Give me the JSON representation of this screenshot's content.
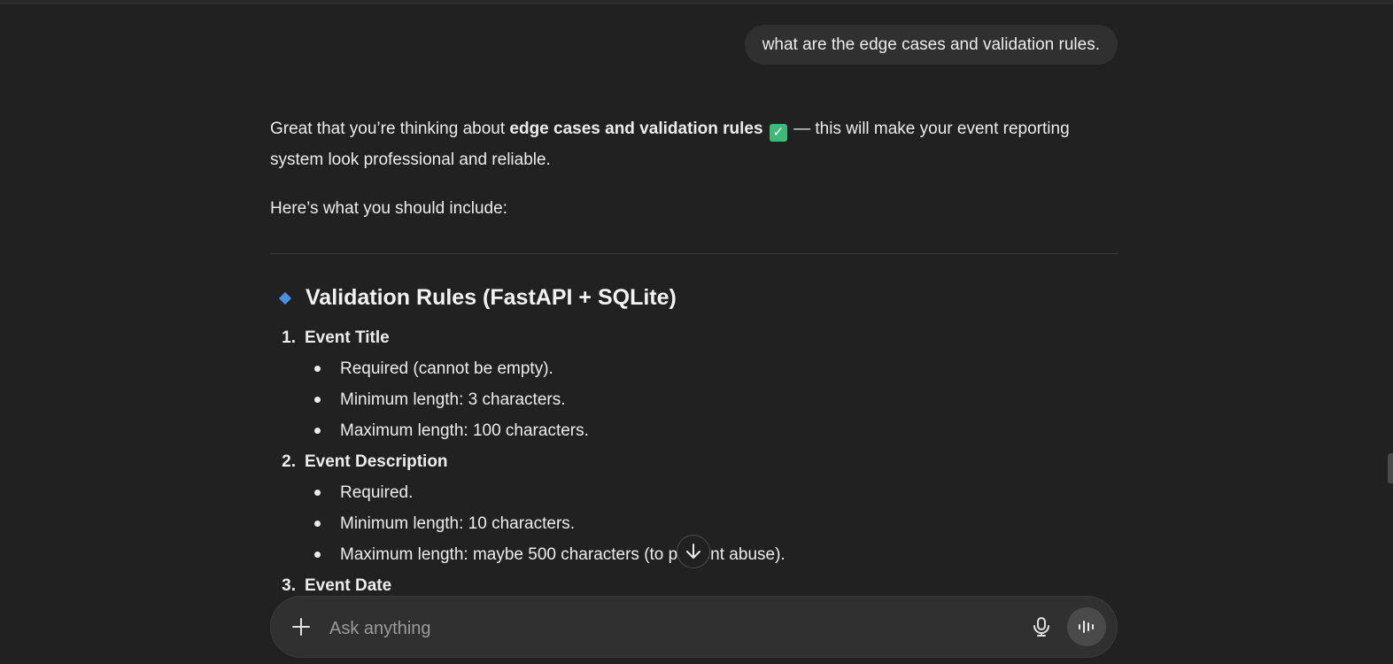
{
  "user_message": "what are the edge cases and validation rules.",
  "answer": {
    "intro_before": "Great that you’re thinking about ",
    "intro_bold": "edge cases and validation rules",
    "intro_check": "✓",
    "intro_after_line1": " — this will make your event reporting",
    "intro_line2": "system look professional and reliable.",
    "lead": "Here’s what you should include:"
  },
  "section": {
    "title": "Validation Rules (FastAPI + SQLite)"
  },
  "rules": [
    {
      "number": "1.",
      "title": "Event Title",
      "items": [
        "Required (cannot be empty).",
        "Minimum length: 3 characters.",
        "Maximum length: 100 characters."
      ]
    },
    {
      "number": "2.",
      "title": "Event Description",
      "items": [
        "Required.",
        "Minimum length: 10 characters.",
        "Maximum length: maybe 500 characters (to prevent abuse)."
      ]
    },
    {
      "number": "3.",
      "title": "Event Date",
      "items": []
    }
  ],
  "composer": {
    "placeholder": "Ask anything",
    "plus_icon": "plus-icon",
    "mic_icon": "microphone-icon",
    "voice_icon": "voice-mode-icon"
  },
  "scroll_button_icon": "arrow-down-icon",
  "colors": {
    "background": "#212121",
    "bubble": "#303030",
    "accent_diamond": "#4a8fe0",
    "check": "#3fb87a"
  }
}
